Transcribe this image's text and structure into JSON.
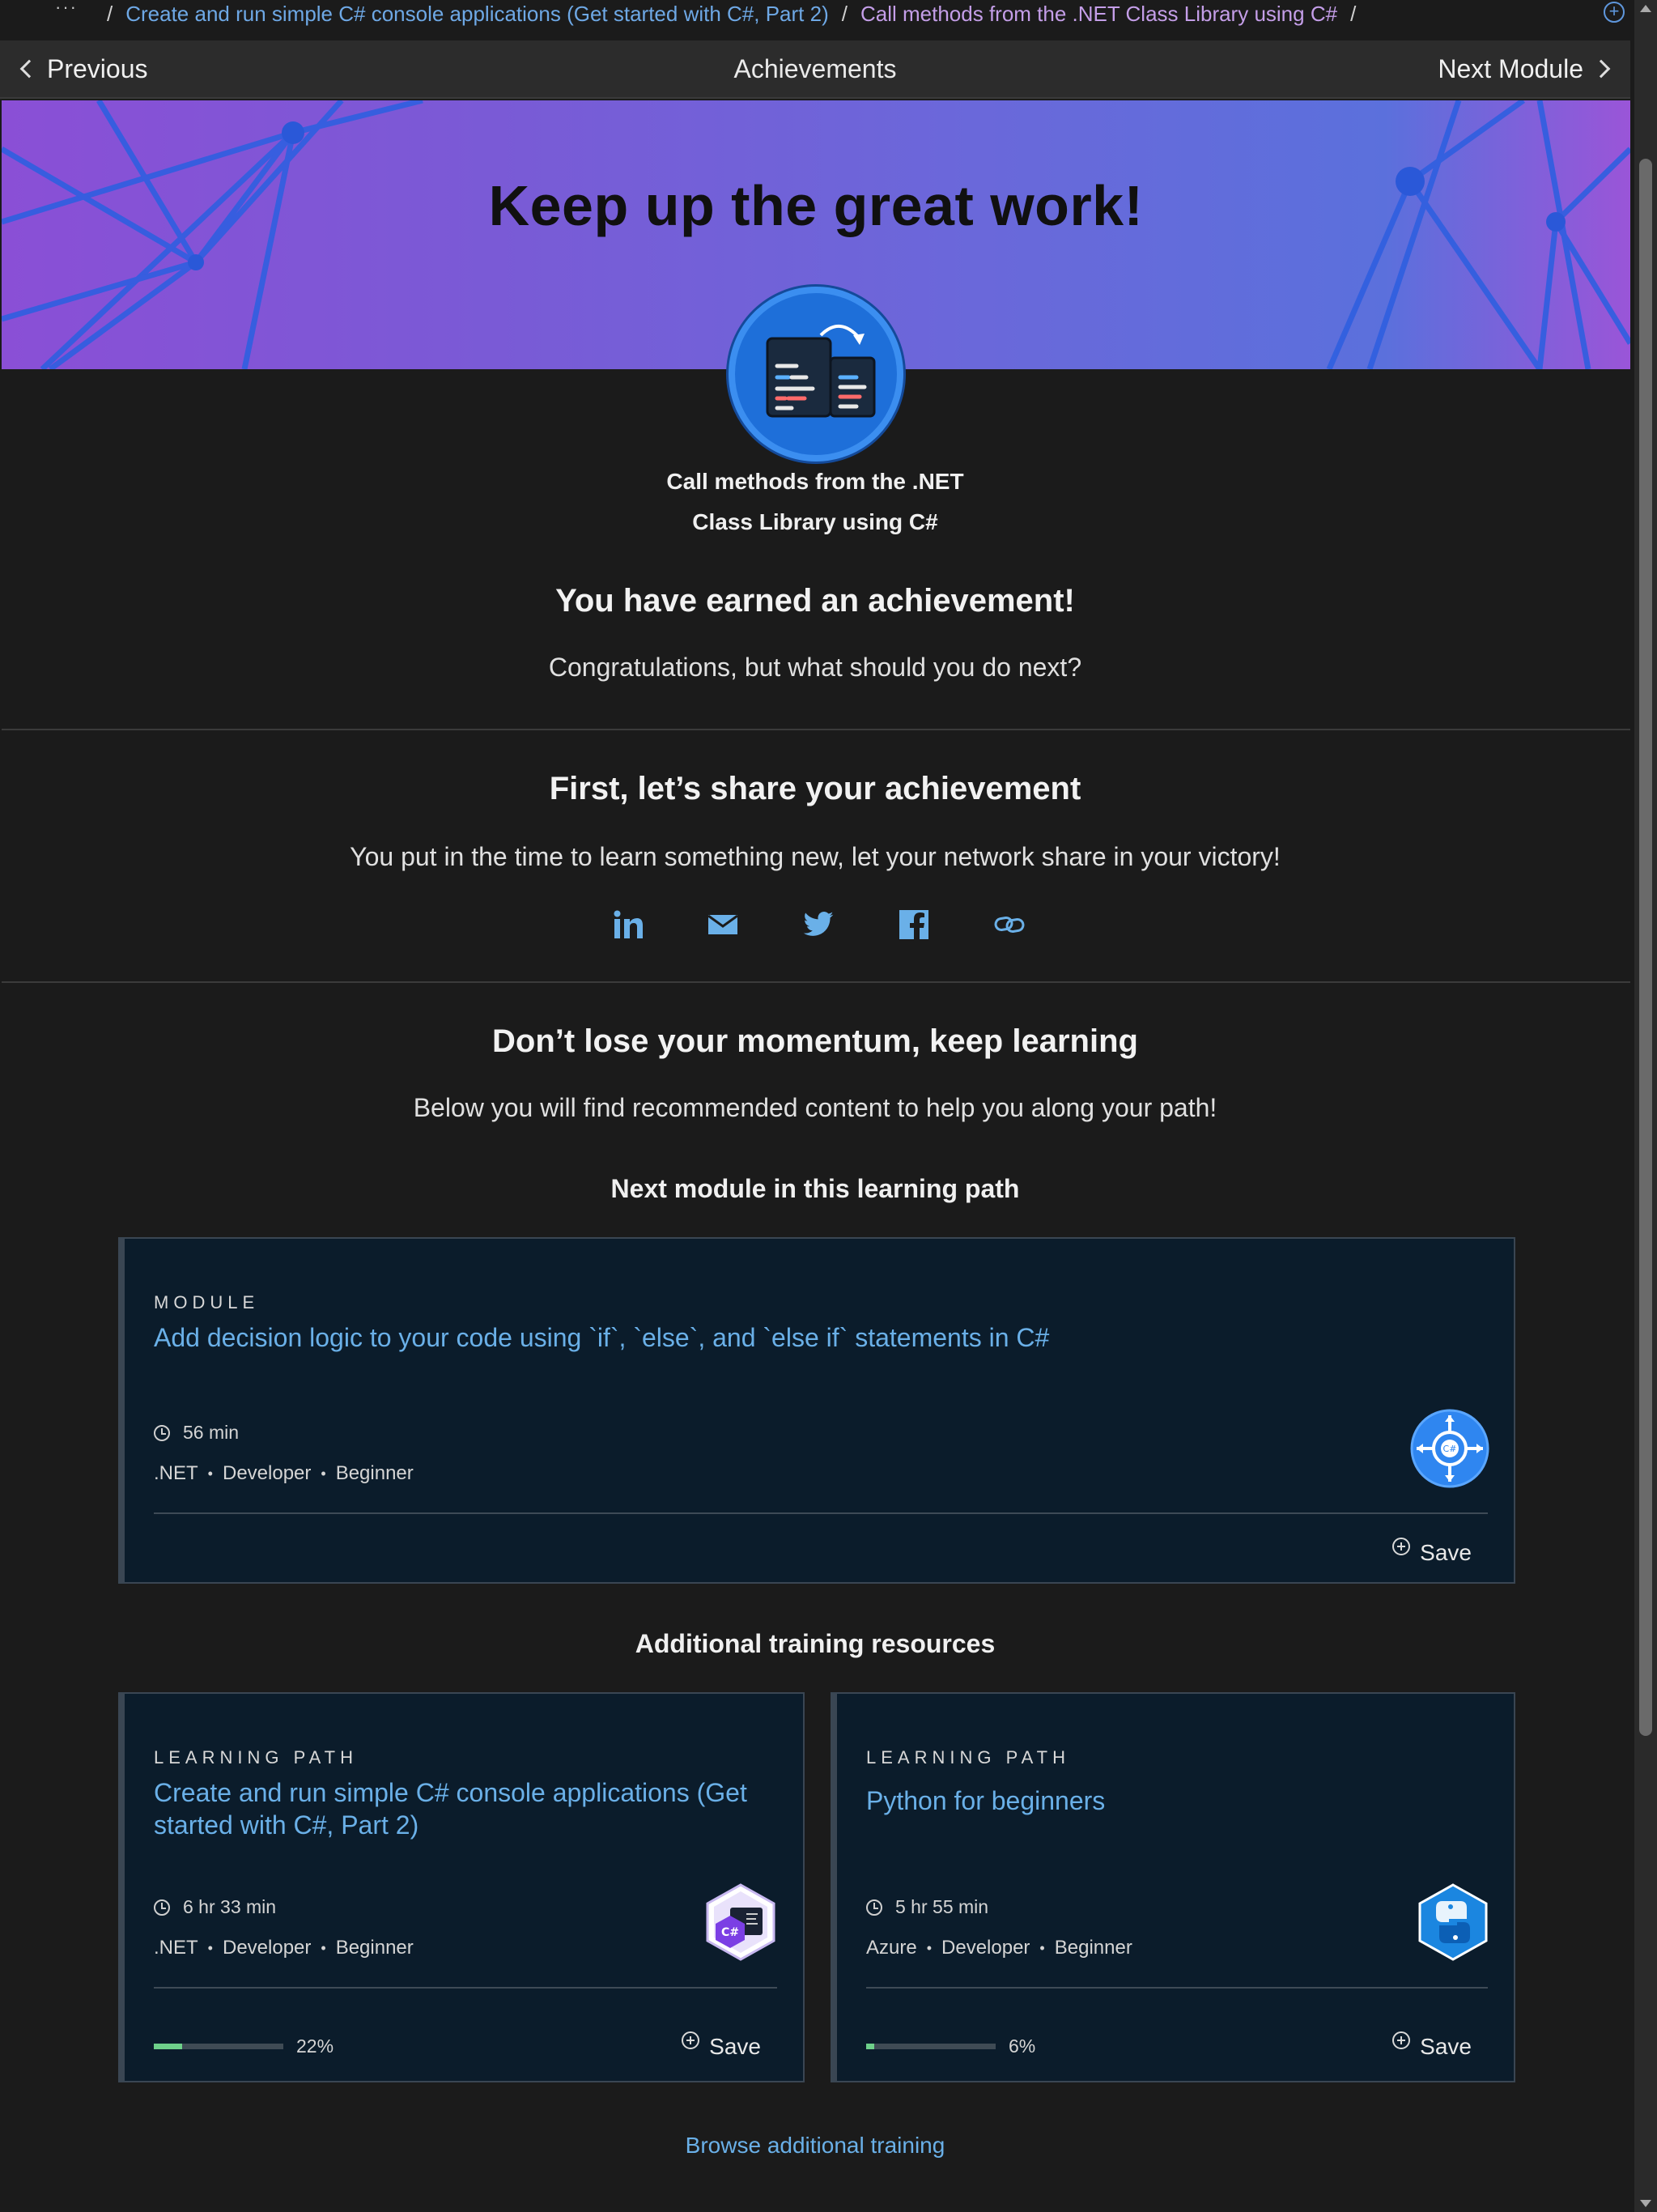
{
  "breadcrumb": {
    "ellipsis": "···",
    "items": [
      "Create and run simple C# console applications (Get started with C#, Part 2)",
      "Call methods from the .NET Class Library using C#"
    ]
  },
  "nav": {
    "previous": "Previous",
    "title": "Achievements",
    "next": "Next Module"
  },
  "banner": {
    "heading": "Keep up the great work!"
  },
  "achievement": {
    "module_line1": "Call methods from the .NET",
    "module_line2": "Class Library using C#",
    "earned": "You have earned an achievement!",
    "congrats": "Congratulations, but what should you do next?"
  },
  "share": {
    "title": "First, let’s share your achievement",
    "subtitle": "You put in the time to learn something new, let your network share in your victory!",
    "icons": [
      "linkedin-icon",
      "email-icon",
      "twitter-icon",
      "facebook-icon",
      "link-icon"
    ]
  },
  "momentum": {
    "title": "Don’t lose your momentum, keep learning",
    "subtitle": "Below you will find recommended content to help you along your path!",
    "next_heading": "Next module in this learning path",
    "additional_heading": "Additional training resources"
  },
  "next_module": {
    "kind": "MODULE",
    "title": "Add decision logic to your code using `if`, `else`, and `else if` statements in C#",
    "duration": "56 min",
    "tags": [
      ".NET",
      "Developer",
      "Beginner"
    ],
    "save": "Save"
  },
  "resources": [
    {
      "kind": "LEARNING PATH",
      "title": "Create and run simple C# console applications (Get started with C#, Part 2)",
      "duration": "6 hr 33 min",
      "tags": [
        ".NET",
        "Developer",
        "Beginner"
      ],
      "progress": "22%",
      "progress_value": 0.22,
      "save": "Save"
    },
    {
      "kind": "LEARNING PATH",
      "title": "Python for beginners",
      "duration": "5 hr 55 min",
      "tags": [
        "Azure",
        "Developer",
        "Beginner"
      ],
      "progress": "6%",
      "progress_value": 0.06,
      "save": "Save"
    }
  ],
  "browse": "Browse additional training",
  "colors": {
    "link": "#6ab0e8",
    "breadcrumb_current": "#c49ee8",
    "card_bg": "#0b1c2b",
    "progress_fill": "#6ed08a"
  }
}
